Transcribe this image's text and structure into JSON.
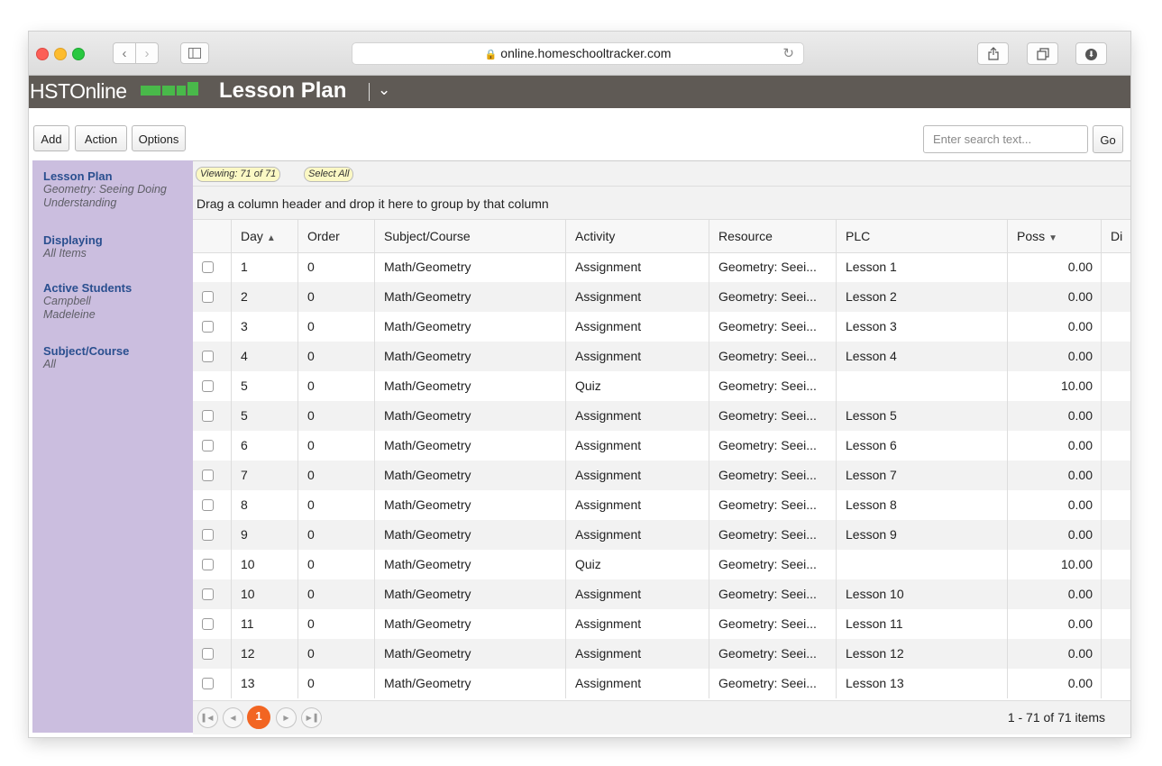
{
  "browser": {
    "url": "online.homeschooltracker.com"
  },
  "app": {
    "brand": "HSTOnline",
    "page_title": "Lesson Plan"
  },
  "toolbar": {
    "add_label": "Add",
    "action_label": "Action",
    "options_label": "Options",
    "search_placeholder": "Enter search text...",
    "go_label": "Go"
  },
  "sidebar": {
    "lesson_plan": {
      "title": "Lesson Plan",
      "value": "Geometry: Seeing Doing Understanding"
    },
    "displaying": {
      "title": "Displaying",
      "value": "All Items"
    },
    "active_students": {
      "title": "Active Students",
      "values": [
        "Campbell",
        "Madeleine"
      ]
    },
    "subject_course": {
      "title": "Subject/Course",
      "value": "All"
    }
  },
  "grid": {
    "viewing_label": "Viewing: 71 of 71",
    "select_all_label": "Select All",
    "group_hint": "Drag a column header and drop it here to group by that column",
    "columns": [
      "Day",
      "Order",
      "Subject/Course",
      "Activity",
      "Resource",
      "PLC",
      "Poss",
      "Di"
    ],
    "rows": [
      {
        "day": "1",
        "order": "0",
        "subject": "Math/Geometry",
        "activity": "Assignment",
        "resource": "Geometry: Seei...",
        "plc": "Lesson 1",
        "poss": "0.00"
      },
      {
        "day": "2",
        "order": "0",
        "subject": "Math/Geometry",
        "activity": "Assignment",
        "resource": "Geometry: Seei...",
        "plc": "Lesson 2",
        "poss": "0.00"
      },
      {
        "day": "3",
        "order": "0",
        "subject": "Math/Geometry",
        "activity": "Assignment",
        "resource": "Geometry: Seei...",
        "plc": "Lesson 3",
        "poss": "0.00"
      },
      {
        "day": "4",
        "order": "0",
        "subject": "Math/Geometry",
        "activity": "Assignment",
        "resource": "Geometry: Seei...",
        "plc": "Lesson 4",
        "poss": "0.00"
      },
      {
        "day": "5",
        "order": "0",
        "subject": "Math/Geometry",
        "activity": "Quiz",
        "resource": "Geometry: Seei...",
        "plc": "",
        "poss": "10.00"
      },
      {
        "day": "5",
        "order": "0",
        "subject": "Math/Geometry",
        "activity": "Assignment",
        "resource": "Geometry: Seei...",
        "plc": "Lesson 5",
        "poss": "0.00"
      },
      {
        "day": "6",
        "order": "0",
        "subject": "Math/Geometry",
        "activity": "Assignment",
        "resource": "Geometry: Seei...",
        "plc": "Lesson 6",
        "poss": "0.00"
      },
      {
        "day": "7",
        "order": "0",
        "subject": "Math/Geometry",
        "activity": "Assignment",
        "resource": "Geometry: Seei...",
        "plc": "Lesson 7",
        "poss": "0.00"
      },
      {
        "day": "8",
        "order": "0",
        "subject": "Math/Geometry",
        "activity": "Assignment",
        "resource": "Geometry: Seei...",
        "plc": "Lesson 8",
        "poss": "0.00"
      },
      {
        "day": "9",
        "order": "0",
        "subject": "Math/Geometry",
        "activity": "Assignment",
        "resource": "Geometry: Seei...",
        "plc": "Lesson 9",
        "poss": "0.00"
      },
      {
        "day": "10",
        "order": "0",
        "subject": "Math/Geometry",
        "activity": "Quiz",
        "resource": "Geometry: Seei...",
        "plc": "",
        "poss": "10.00"
      },
      {
        "day": "10",
        "order": "0",
        "subject": "Math/Geometry",
        "activity": "Assignment",
        "resource": "Geometry: Seei...",
        "plc": "Lesson 10",
        "poss": "0.00"
      },
      {
        "day": "11",
        "order": "0",
        "subject": "Math/Geometry",
        "activity": "Assignment",
        "resource": "Geometry: Seei...",
        "plc": "Lesson 11",
        "poss": "0.00"
      },
      {
        "day": "12",
        "order": "0",
        "subject": "Math/Geometry",
        "activity": "Assignment",
        "resource": "Geometry: Seei...",
        "plc": "Lesson 12",
        "poss": "0.00"
      },
      {
        "day": "13",
        "order": "0",
        "subject": "Math/Geometry",
        "activity": "Assignment",
        "resource": "Geometry: Seei...",
        "plc": "Lesson 13",
        "poss": "0.00"
      }
    ]
  },
  "pager": {
    "current_page": "1",
    "info": "1 - 71 of 71 items"
  },
  "colors": {
    "header_bg": "#5f5a55",
    "sidebar_bg": "#cbbedf",
    "link_blue": "#2a4f8f",
    "current_page": "#f26522",
    "logo_green": "#49b94a"
  }
}
